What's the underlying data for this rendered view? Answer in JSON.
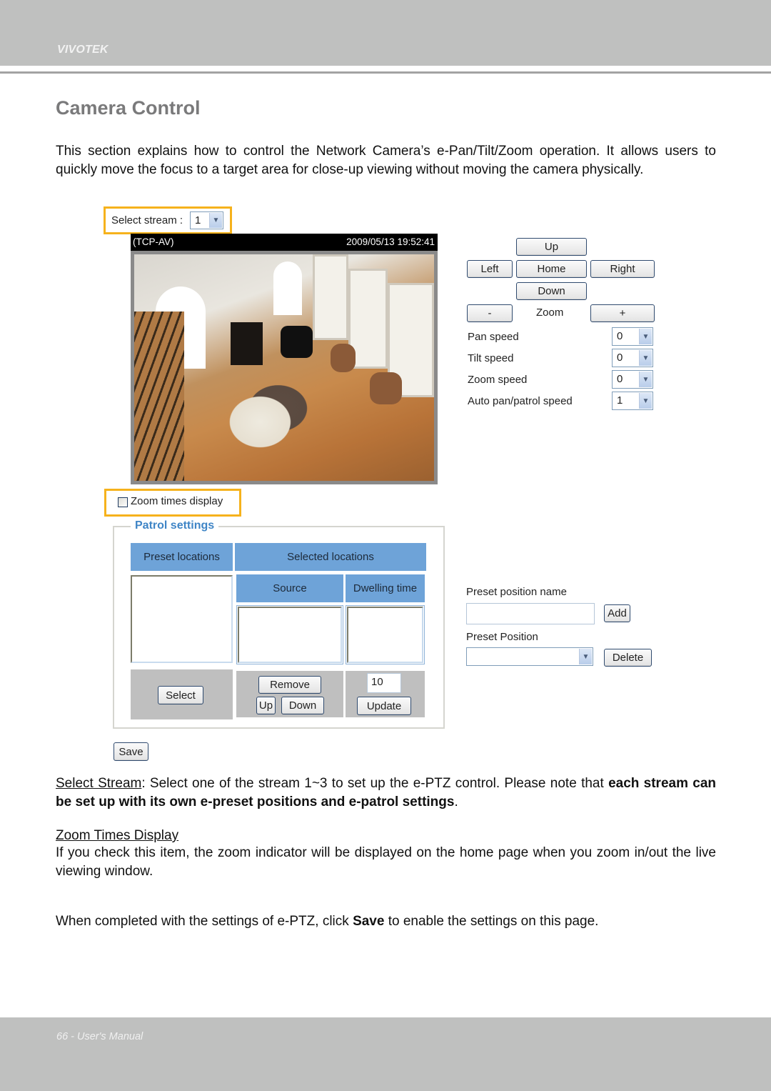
{
  "header": {
    "brand": "VIVOTEK"
  },
  "page": {
    "title": "Camera Control",
    "intro": "This section explains how to control the Network Camera’s e-Pan/Tilt/Zoom operation. It allows users to quickly move the focus to a target area for close-up viewing without moving the camera physically."
  },
  "stream": {
    "label": "Select stream :",
    "value": "1"
  },
  "camera": {
    "protocol": "(TCP-AV)",
    "timestamp": "2009/05/13 19:52:41",
    "image_desc": "live view of living room from above"
  },
  "ptz": {
    "up": "Up",
    "left": "Left",
    "home": "Home",
    "right": "Right",
    "down": "Down",
    "zoom_out": "-",
    "zoom_label": "Zoom",
    "zoom_in": "+",
    "speeds": [
      {
        "label": "Pan speed",
        "value": "0"
      },
      {
        "label": "Tilt speed",
        "value": "0"
      },
      {
        "label": "Zoom speed",
        "value": "0"
      },
      {
        "label": "Auto pan/patrol speed",
        "value": "1"
      }
    ]
  },
  "zoom_display": {
    "label": "Zoom times display",
    "checked": false
  },
  "patrol": {
    "legend": "Patrol settings",
    "preset_locations_header": "Preset locations",
    "selected_locations_header": "Selected locations",
    "source_header": "Source",
    "dwelling_header": "Dwelling time",
    "select_button": "Select",
    "remove_button": "Remove",
    "up_button": "Up",
    "down_button": "Down",
    "dwell_value": "10",
    "update_button": "Update"
  },
  "preset": {
    "name_label": "Preset position name",
    "name_value": "",
    "add_button": "Add",
    "position_label": "Preset Position",
    "position_value": "",
    "delete_button": "Delete"
  },
  "save_button": "Save",
  "body": {
    "select_stream_term": "Select Stream",
    "select_stream_text": ": Select one of the stream 1~3 to set up the e-PTZ control. Please note that ",
    "select_stream_bold": "each stream can be set up with its own e-preset positions and e-patrol settings",
    "select_stream_end": ".",
    "zoom_times_term": "Zoom Times Display",
    "zoom_times_text": "If you check this item, the zoom indicator will be displayed on the home page when you zoom in/out the live viewing window.",
    "final_pre": "When completed with the settings of e-PTZ, click ",
    "final_bold": "Save",
    "final_post": " to enable the settings on this page."
  },
  "footer": {
    "text": "66 - User's Manual"
  }
}
